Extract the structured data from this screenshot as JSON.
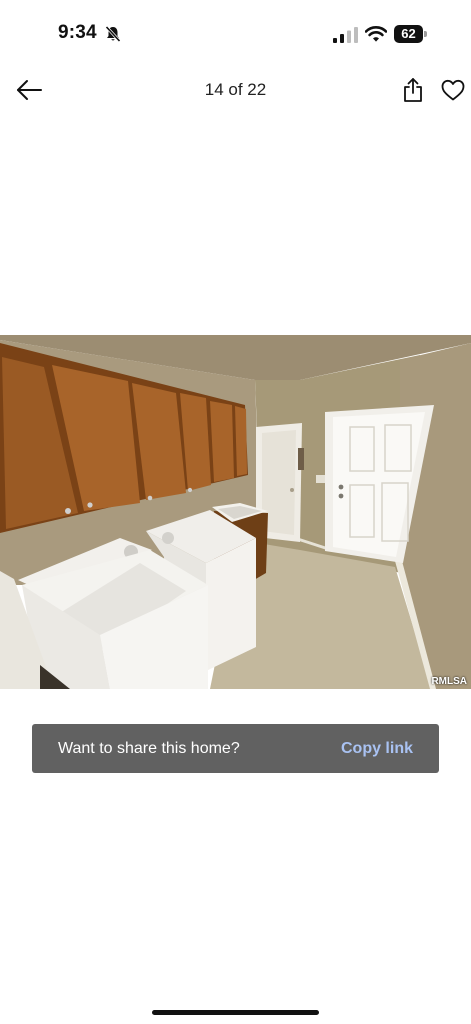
{
  "status_bar": {
    "time": "9:34",
    "battery": "62",
    "icons": [
      "bell-slash-icon",
      "cellular-signal-icon",
      "wifi-icon",
      "battery-icon"
    ]
  },
  "header": {
    "counter": "14 of 22",
    "icons": [
      "arrow-left-icon",
      "share-icon",
      "heart-icon"
    ]
  },
  "photo": {
    "watermark": "RMLSA"
  },
  "share_banner": {
    "prompt": "Want to share this home?",
    "action": "Copy link",
    "action_color": "#a9c2f2",
    "background": "#616161"
  }
}
